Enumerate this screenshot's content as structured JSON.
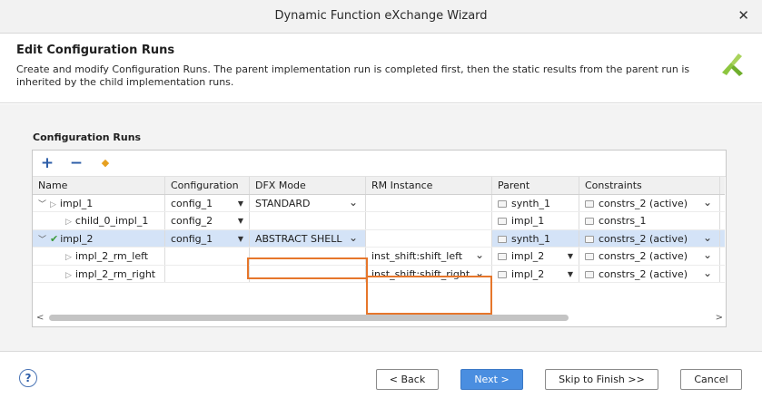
{
  "window": {
    "title": "Dynamic Function eXchange Wizard",
    "close_glyph": "✕"
  },
  "header": {
    "title": "Edit Configuration Runs",
    "description": "Create and modify Configuration Runs. The parent implementation run is completed first, then the static results from the parent run is inherited by the child implementation runs."
  },
  "section": {
    "label": "Configuration Runs"
  },
  "toolbar": {
    "add_label": "+",
    "remove_label": "−",
    "edit_label": "◆"
  },
  "columns": [
    "Name",
    "Configuration",
    "DFX Mode",
    "RM Instance",
    "Parent",
    "Constraints"
  ],
  "rows": [
    {
      "name": "impl_1",
      "configuration": "config_1",
      "dfx_mode": "STANDARD",
      "rm_instance": "",
      "parent": "synth_1",
      "constraints": "constrs_2 (active)"
    },
    {
      "name": "child_0_impl_1",
      "configuration": "config_2",
      "dfx_mode": "",
      "rm_instance": "",
      "parent": "impl_1",
      "constraints": "constrs_1"
    },
    {
      "name": "impl_2",
      "configuration": "config_1",
      "dfx_mode": "ABSTRACT SHELL",
      "rm_instance": "",
      "parent": "synth_1",
      "constraints": "constrs_2 (active)"
    },
    {
      "name": "impl_2_rm_left",
      "configuration": "",
      "dfx_mode": "",
      "rm_instance": "inst_shift:shift_left",
      "parent": "impl_2",
      "constraints": "constrs_2 (active)"
    },
    {
      "name": "impl_2_rm_right",
      "configuration": "",
      "dfx_mode": "",
      "rm_instance": "inst_shift:shift_right",
      "parent": "impl_2",
      "constraints": "constrs_2 (active)"
    }
  ],
  "footer": {
    "help_label": "?",
    "back_label": "< Back",
    "next_label": "Next >",
    "skip_label": "Skip to Finish >>",
    "cancel_label": "Cancel"
  },
  "colors": {
    "accent": "#4a8ee0",
    "highlight": "#e6762b",
    "selected_row": "#d4e3f7",
    "logo_green": "#8dc63f"
  },
  "icons": [
    "close-icon",
    "xilinx-logo",
    "add-icon",
    "remove-icon",
    "edit-icon",
    "expand-icon",
    "collapse-icon",
    "checkmark-icon",
    "folder-icon",
    "dropdown-icon",
    "help-icon"
  ]
}
